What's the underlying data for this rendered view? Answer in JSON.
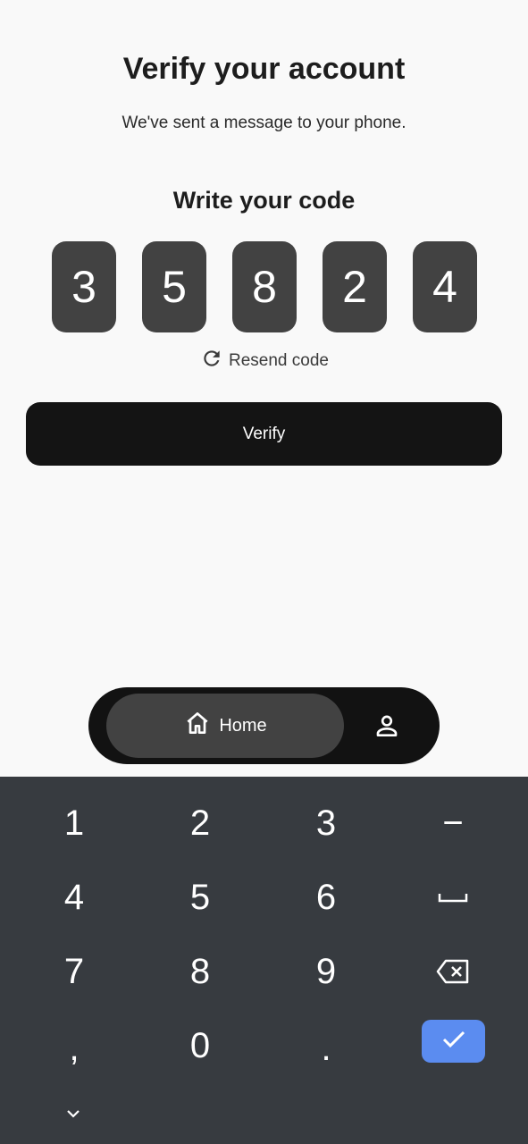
{
  "header": {
    "title": "Verify your account",
    "subtitle": "We've sent a message to your phone."
  },
  "code": {
    "heading": "Write your code",
    "digits": [
      "3",
      "5",
      "8",
      "2",
      "4"
    ],
    "resend_label": "Resend code"
  },
  "verify_button": {
    "label": "Verify"
  },
  "bottom_nav": {
    "home_label": "Home"
  },
  "keyboard": {
    "keys": {
      "k1": "1",
      "k2": "2",
      "k3": "3",
      "kdash": "−",
      "k4": "4",
      "k5": "5",
      "k6": "6",
      "k7": "7",
      "k8": "8",
      "k9": "9",
      "kcomma": ",",
      "k0": "0",
      "kdot": "."
    }
  },
  "colors": {
    "background": "#f9f9f9",
    "code_box": "#424242",
    "button": "#141414",
    "keyboard": "#373b40",
    "accent": "#5b8cf0"
  }
}
